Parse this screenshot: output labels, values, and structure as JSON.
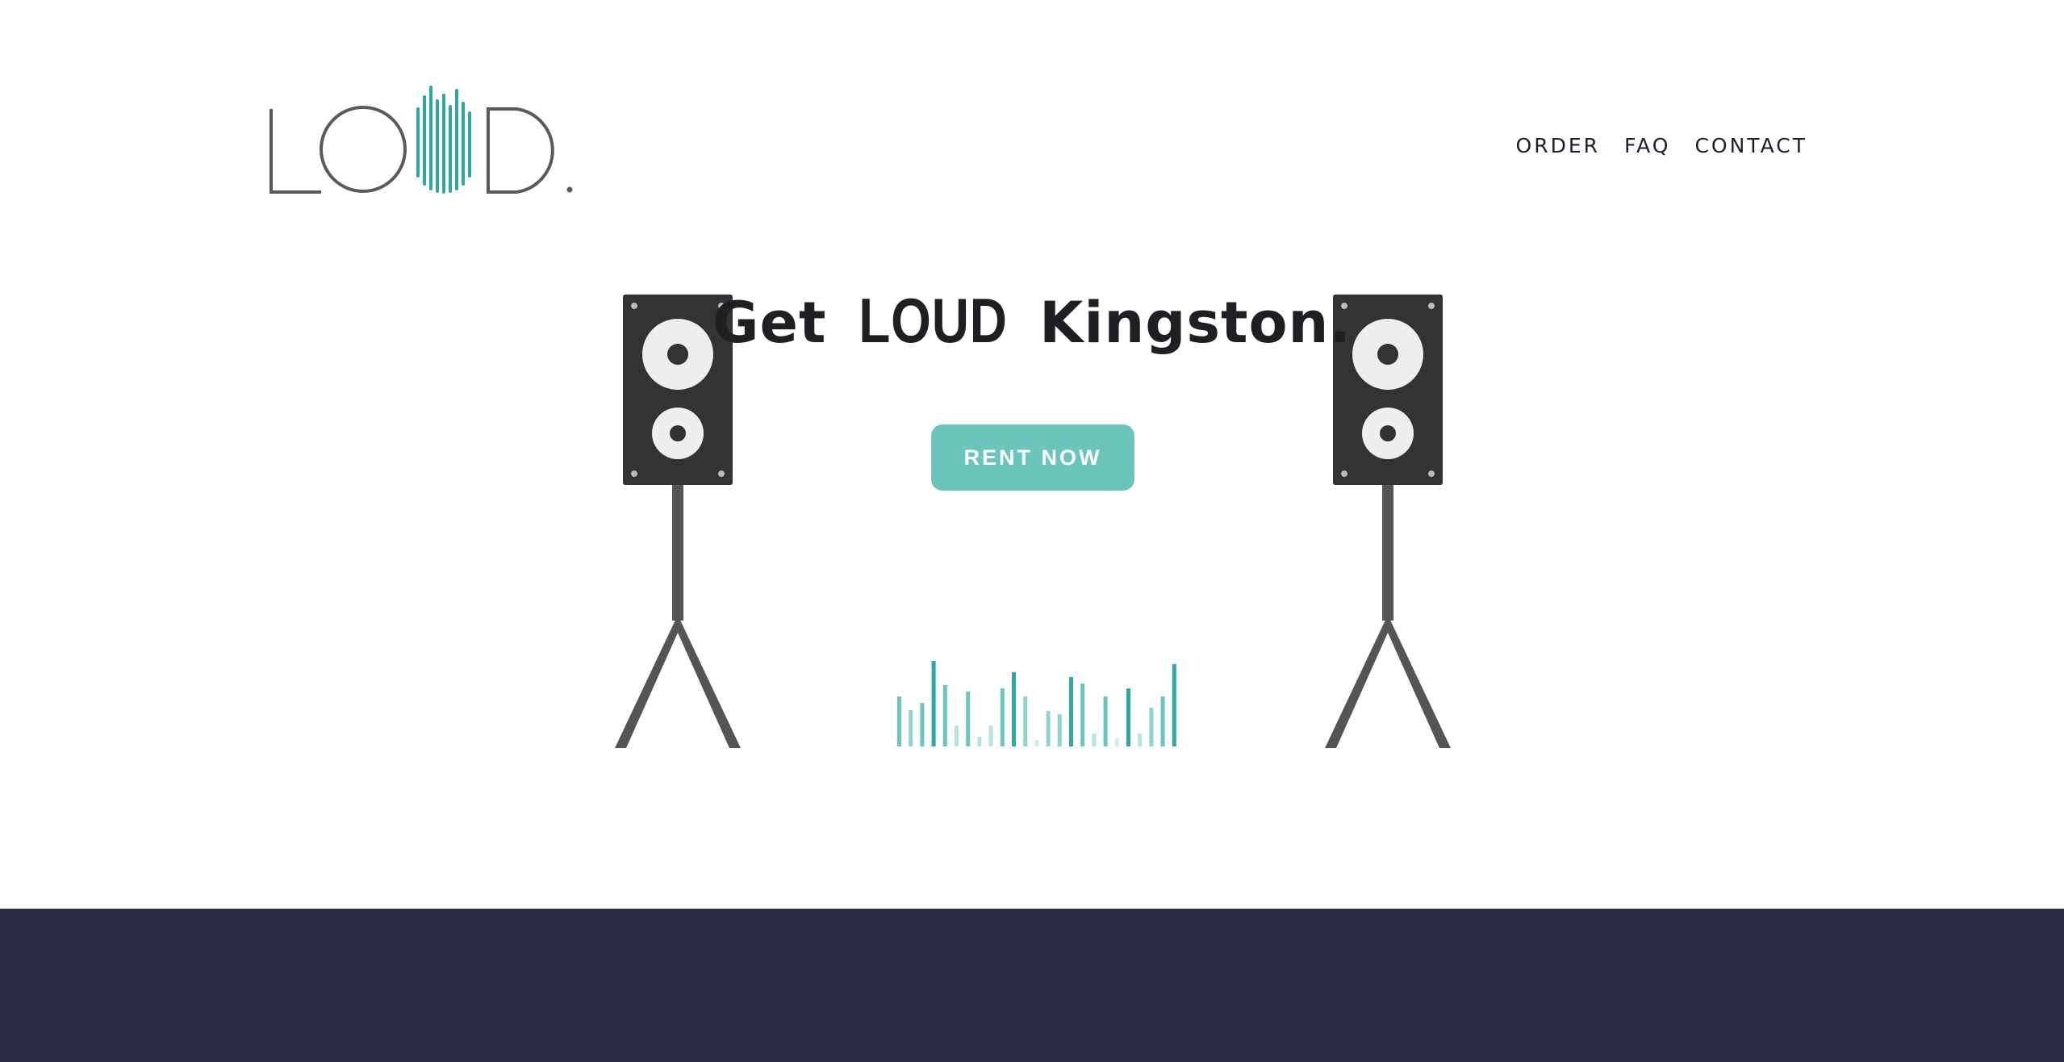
{
  "brand": {
    "name": "LOUD",
    "accent_color": "#2fa8a0",
    "logo_color": "#5a5a5a"
  },
  "nav": {
    "items": [
      {
        "label": "ORDER"
      },
      {
        "label": "FAQ"
      },
      {
        "label": "CONTACT"
      }
    ]
  },
  "hero": {
    "headline_prefix": "Get",
    "headline_strong": "LOUD",
    "headline_suffix": "Kingston.",
    "cta_label": "RENT NOW",
    "cta_color": "#6cc5bd"
  },
  "decor": {
    "speaker_icon": "speaker-on-stand-icon",
    "equalizer_icon": "equalizer-bars-icon",
    "speaker_color": "#333333",
    "stand_color": "#555555"
  },
  "footer": {
    "background_color": "#2b2c43"
  }
}
